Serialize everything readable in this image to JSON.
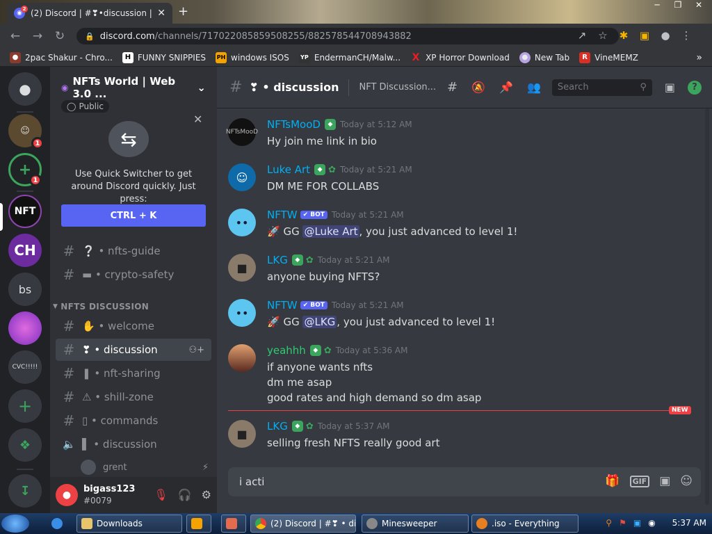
{
  "browser": {
    "tab_title": "(2) Discord | #❣•discussion | NF",
    "tab_badge": "2",
    "url_domain": "discord.com",
    "url_path": "/channels/717022085859508255/882578544708943882"
  },
  "bookmarks": [
    {
      "label": "2pac Shakur - Chro...",
      "icon": "2pac-icon",
      "color": "#8b3a2e"
    },
    {
      "label": "FUNNY SNIPPIES",
      "icon": "h-icon",
      "color": "#ffffff"
    },
    {
      "label": "windows ISOS",
      "icon": "ph-icon",
      "color": "#f4a300"
    },
    {
      "label": "EndermanCH/Malw...",
      "icon": "yp-icon",
      "color": "#333333"
    },
    {
      "label": "XP Horror Download",
      "icon": "x-icon",
      "color": "#ed1c24"
    },
    {
      "label": "New Tab",
      "icon": "newtab-icon",
      "color": "#b6a4e0"
    },
    {
      "label": "VineMEMZ",
      "icon": "r-icon",
      "color": "#d93025"
    }
  ],
  "server": {
    "name": "NFTs World | Web 3.0 ...",
    "public_label": "Public"
  },
  "quick_switcher": {
    "text": "Use Quick Switcher to get around Discord quickly. Just press:",
    "button": "CTRL + K"
  },
  "guilds": {
    "badges": [
      "1",
      "1"
    ],
    "bs_label": "bs",
    "cvc_label": "CVC!!!!!",
    "ch_label": "CH"
  },
  "channels": {
    "top": [
      {
        "name": "❔ • nfts-guide"
      },
      {
        "name": "▬ • crypto-safety"
      }
    ],
    "category": "NFTS DISCUSSION",
    "list": [
      {
        "name": "✋ • welcome"
      },
      {
        "name": "❣ • discussion"
      },
      {
        "name": "❚ • nft-sharing"
      },
      {
        "name": "⚠ • shill-zone"
      },
      {
        "name": "▯ • commands"
      },
      {
        "name": "▌ • discussion"
      }
    ],
    "voice_user": "grent"
  },
  "user": {
    "name": "bigass123",
    "tag": "#0079"
  },
  "topbar": {
    "channel": "❣ • discussion",
    "topic": "NFT Discussion...",
    "search_placeholder": "Search"
  },
  "messages": [
    {
      "author": "NFTsMooD",
      "time": "Today at 5:12 AM",
      "color": "#00b0f4",
      "bot": false,
      "lines": [
        "Hy join me link in bio"
      ]
    },
    {
      "author": "Luke Art",
      "time": "Today at 5:21 AM",
      "color": "#00b0f4",
      "bot": false,
      "lines": [
        "DM ME FOR COLLABS"
      ]
    },
    {
      "author": "NFTW",
      "time": "Today at 5:21 AM",
      "color": "#00b0f4",
      "bot": true,
      "bot_label": "✔ BOT",
      "pre": "🚀 GG ",
      "mention": "@Luke Art",
      "post": ", you just advanced to level 1!"
    },
    {
      "author": "LKG",
      "time": "Today at 5:21 AM",
      "color": "#00b0f4",
      "bot": false,
      "lines": [
        "anyone buying NFTS?"
      ]
    },
    {
      "author": "NFTW",
      "time": "Today at 5:21 AM",
      "color": "#00b0f4",
      "bot": true,
      "bot_label": "✔ BOT",
      "pre": "🚀 GG ",
      "mention": "@LKG",
      "post": ", you just advanced to level 1!"
    },
    {
      "author": "yeahhh",
      "time": "Today at 5:36 AM",
      "color": "#2ecc71",
      "bot": false,
      "lines": [
        "if anyone wants nfts",
        "dm me asap",
        "good rates and high demand so dm asap"
      ]
    },
    {
      "author": "LKG",
      "time": "Today at 5:37 AM",
      "color": "#00b0f4",
      "bot": false,
      "lines": [
        "selling fresh NFTS really good art"
      ]
    }
  ],
  "new_label": "NEW",
  "compose": {
    "value": "i acti"
  },
  "taskbar": {
    "items": [
      "Downloads",
      "",
      "",
      "(2) Discord | #❣ • dis...",
      "Minesweeper",
      ".iso - Everything"
    ],
    "clock": "5:37 AM"
  }
}
